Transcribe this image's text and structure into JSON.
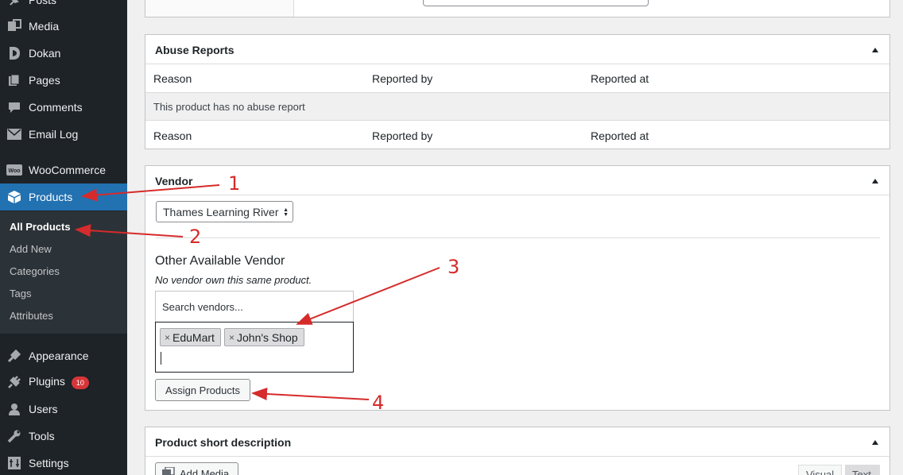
{
  "sidebar": {
    "items": [
      {
        "label": "Posts",
        "icon": "pin-icon"
      },
      {
        "label": "Media",
        "icon": "media-icon"
      },
      {
        "label": "Dokan",
        "icon": "dokan-icon"
      },
      {
        "label": "Pages",
        "icon": "pages-icon"
      },
      {
        "label": "Comments",
        "icon": "comments-icon"
      },
      {
        "label": "Email Log",
        "icon": "email-icon"
      },
      {
        "label": "WooCommerce",
        "icon": "woocommerce-icon"
      },
      {
        "label": "Products",
        "icon": "products-icon"
      },
      {
        "label": "Appearance",
        "icon": "appearance-icon"
      },
      {
        "label": "Plugins",
        "icon": "plugins-icon",
        "badge": "10"
      },
      {
        "label": "Users",
        "icon": "users-icon"
      },
      {
        "label": "Tools",
        "icon": "tools-icon"
      },
      {
        "label": "Settings",
        "icon": "settings-icon"
      }
    ],
    "submenu": [
      "All Products",
      "Add New",
      "Categories",
      "Tags",
      "Attributes"
    ]
  },
  "abuse": {
    "title": "Abuse Reports",
    "headers": [
      "Reason",
      "Reported by",
      "Reported at"
    ],
    "empty_message": "This product has no abuse report",
    "footers": [
      "Reason",
      "Reported by",
      "Reported at"
    ]
  },
  "vendor": {
    "title": "Vendor",
    "selected": "Thames Learning River",
    "other_title": "Other Available Vendor",
    "other_note": "No vendor own this same product.",
    "search_placeholder": "Search vendors...",
    "tokens": [
      "EduMart",
      "John's Shop"
    ],
    "token_remove": "×",
    "assign_button": "Assign Products"
  },
  "short_desc": {
    "title": "Product short description",
    "add_media": "Add Media",
    "tab_visual": "Visual",
    "tab_text": "Text"
  },
  "annotations": [
    "1",
    "2",
    "3",
    "4"
  ],
  "colors": {
    "sidebar_bg": "#1d2327",
    "accent": "#2271b1",
    "annotation": "#d62b2b",
    "badge": "#d63638"
  }
}
